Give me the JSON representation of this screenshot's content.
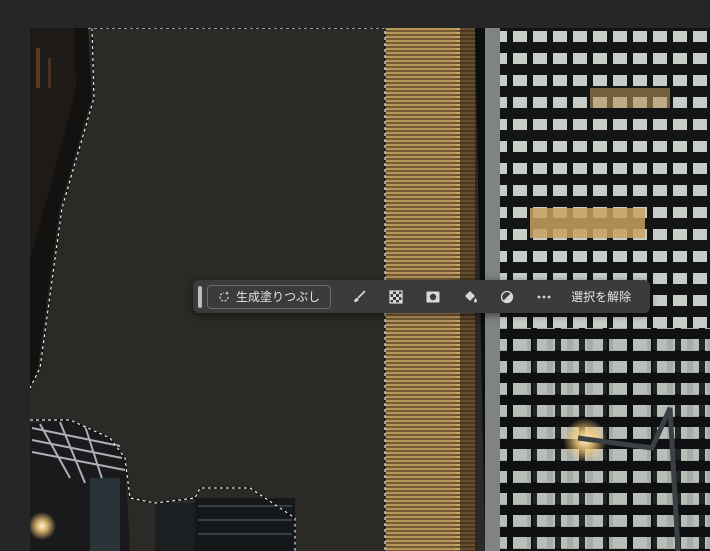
{
  "app": {
    "background_color": "#262626"
  },
  "contextual_taskbar": {
    "generative_fill_label": "生成塗りつぶし",
    "deselect_label": "選択を解除",
    "buttons": [
      {
        "icon": "brush-icon"
      },
      {
        "icon": "checkerboard-mask-icon"
      },
      {
        "icon": "mask-icon"
      },
      {
        "icon": "paint-bucket-icon"
      },
      {
        "icon": "half-circle-adjustment-icon"
      },
      {
        "icon": "more-options-icon"
      }
    ]
  }
}
